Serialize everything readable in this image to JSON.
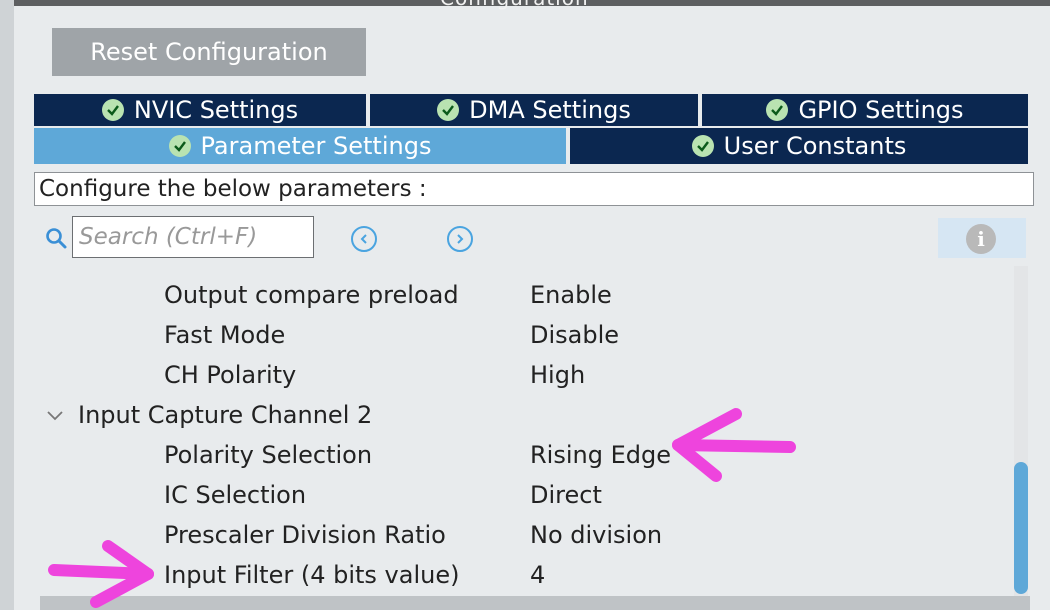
{
  "header": {
    "title": "Configuration"
  },
  "toolbar": {
    "reset_label": "Reset Configuration"
  },
  "tabs": [
    {
      "label": "NVIC Settings",
      "active": false
    },
    {
      "label": "DMA Settings",
      "active": false
    },
    {
      "label": "GPIO Settings",
      "active": false
    },
    {
      "label": "Parameter Settings",
      "active": true
    },
    {
      "label": "User Constants",
      "active": false
    }
  ],
  "config": {
    "prompt": "Configure the below parameters :"
  },
  "search": {
    "placeholder": "Search (Ctrl+F)"
  },
  "params": {
    "rows": [
      {
        "name": "Output compare preload",
        "value": "Enable"
      },
      {
        "name": "Fast Mode",
        "value": "Disable"
      },
      {
        "name": "CH Polarity",
        "value": "High"
      }
    ],
    "group": {
      "label": "Input Capture Channel 2"
    },
    "group_rows": [
      {
        "name": "Polarity Selection",
        "value": "Rising Edge"
      },
      {
        "name": "IC Selection",
        "value": "Direct"
      },
      {
        "name": "Prescaler Division Ratio",
        "value": "No division"
      },
      {
        "name": "Input Filter (4 bits value)",
        "value": "4"
      }
    ]
  },
  "colors": {
    "tab_dark": "#0b2750",
    "tab_active": "#5ea8d8",
    "annotation": "#ee44dd"
  }
}
